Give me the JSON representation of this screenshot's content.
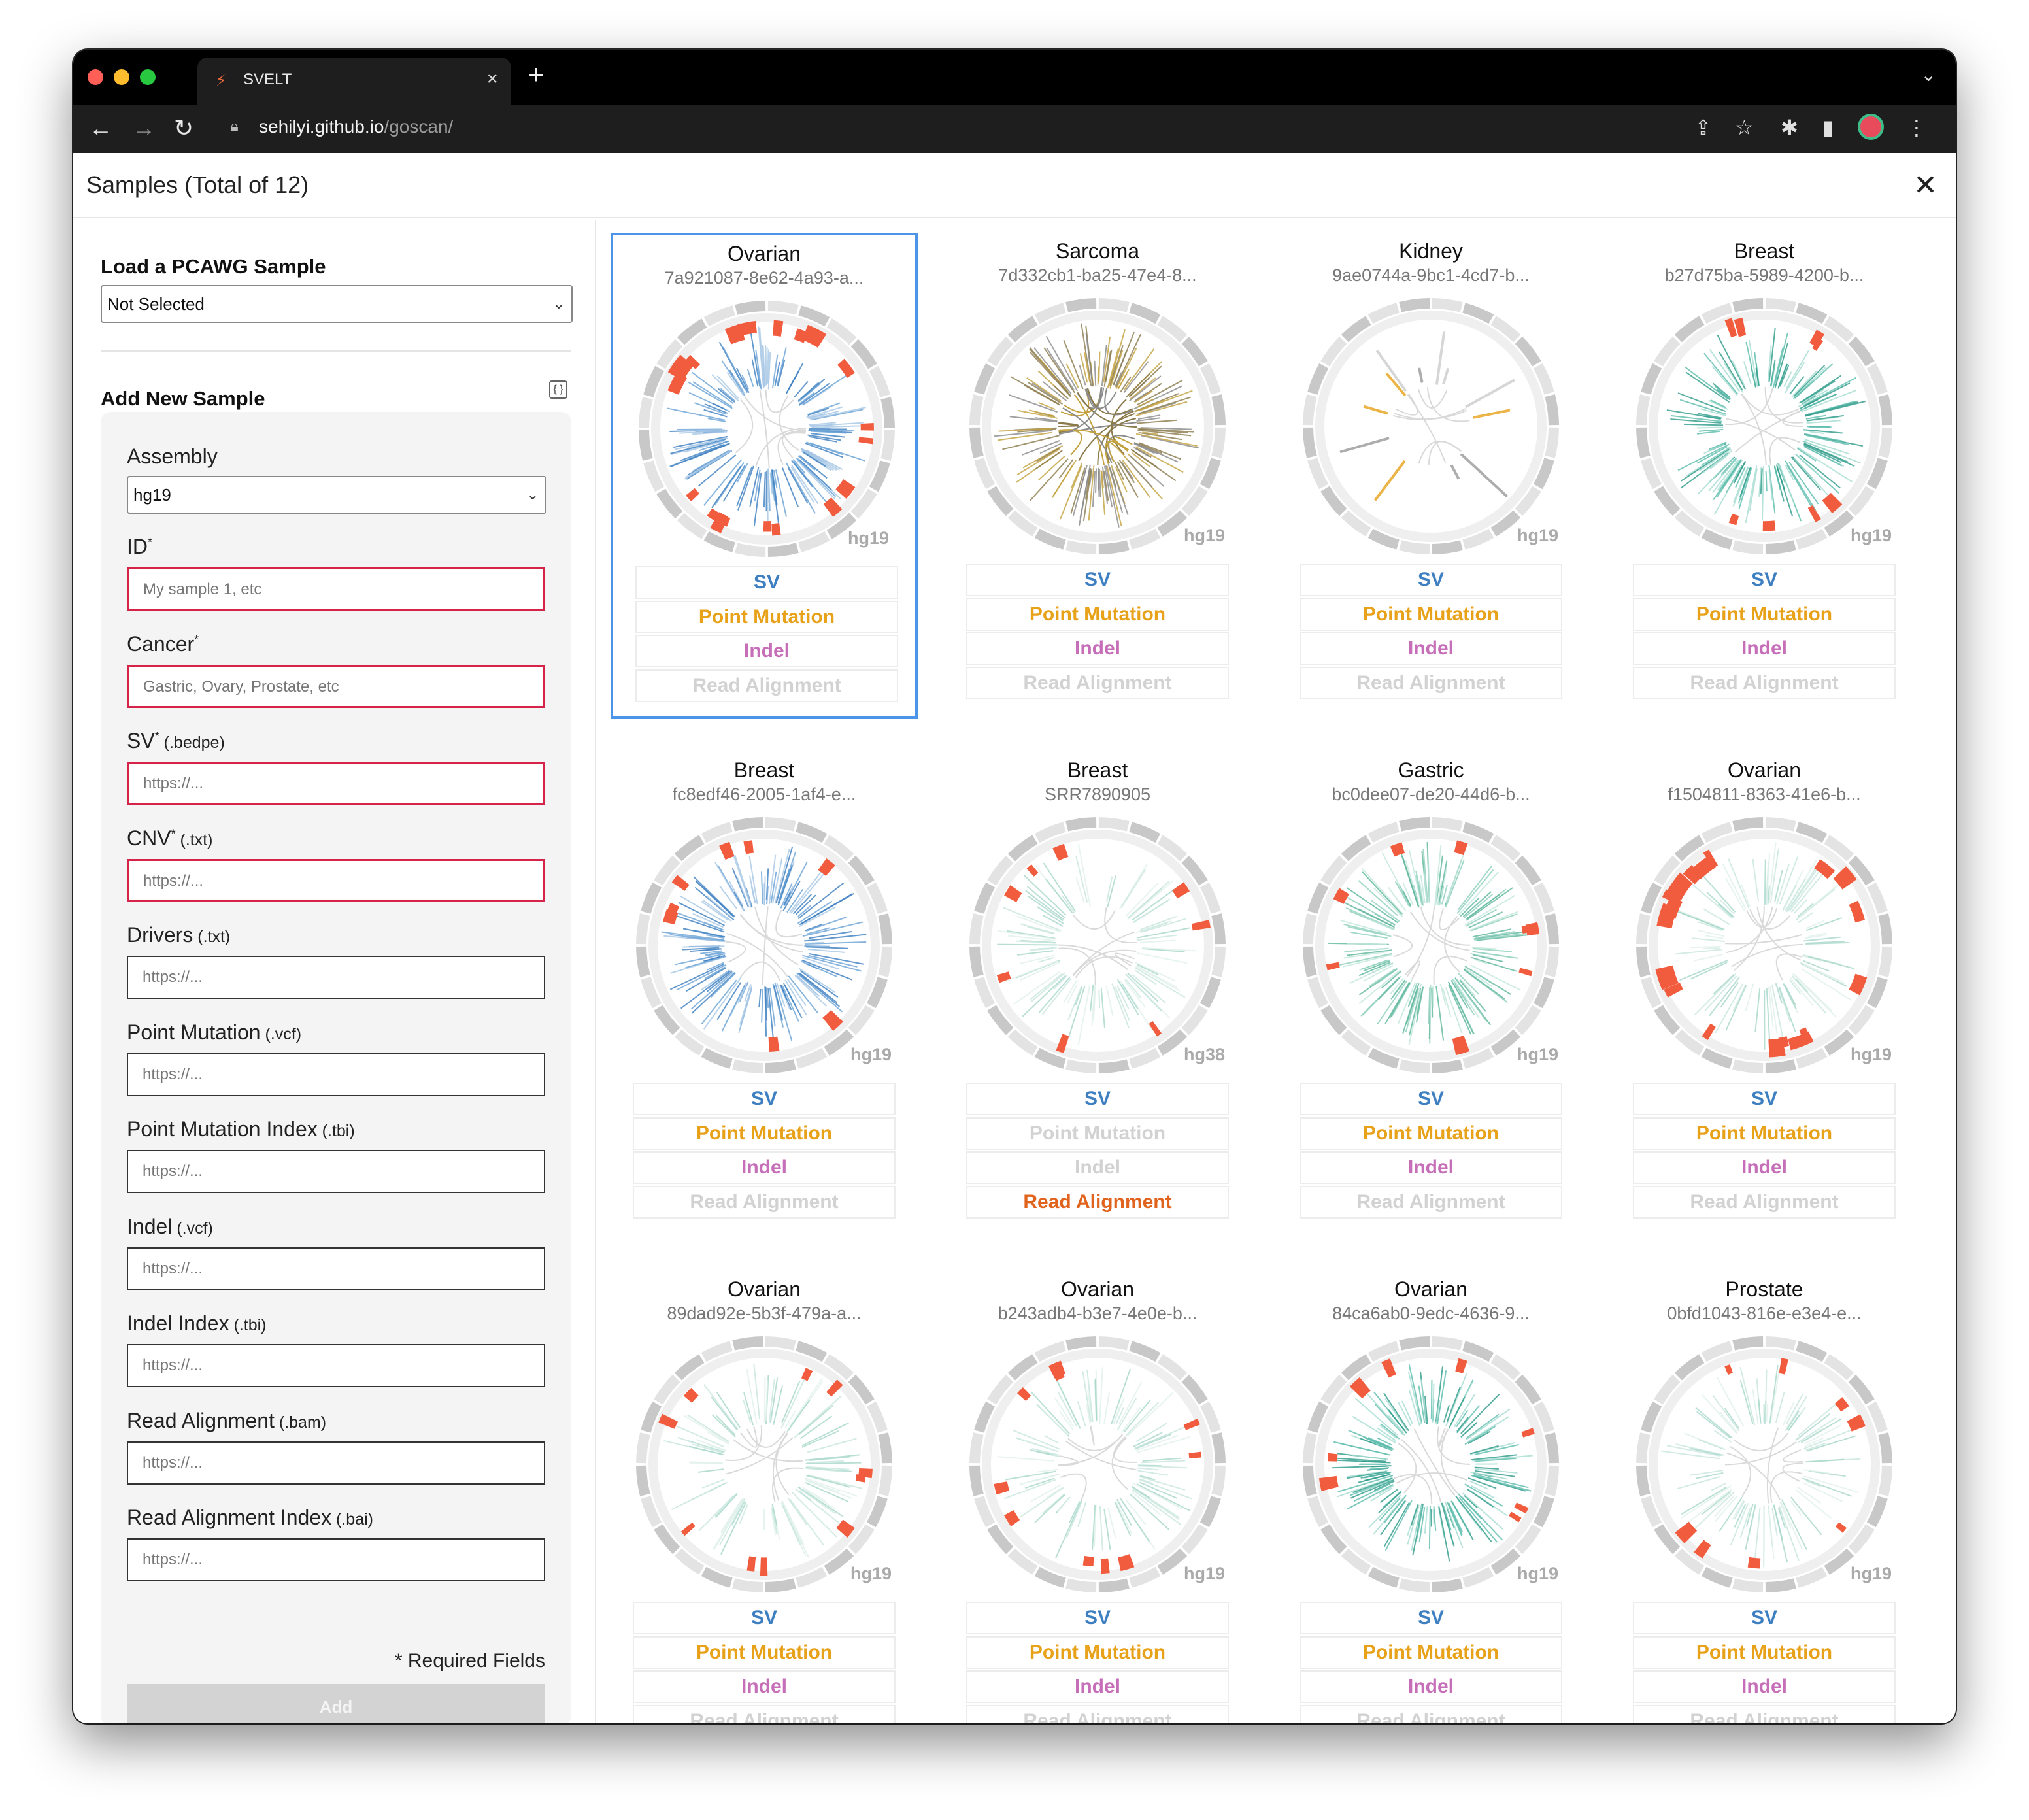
{
  "browser": {
    "tab_title": "SVELT",
    "url_host": "sehilyi.github.io",
    "url_path": "/goscan/"
  },
  "page": {
    "title": "Samples (Total of 12)"
  },
  "sidebar": {
    "load_heading": "Load a PCAWG Sample",
    "load_select_value": "Not Selected",
    "add_heading": "Add New Sample",
    "assembly_label": "Assembly",
    "assembly_value": "hg19",
    "fields": [
      {
        "label": "ID",
        "star": "*",
        "ext": "",
        "placeholder": "My sample 1, etc",
        "required": true
      },
      {
        "label": "Cancer",
        "star": "*",
        "ext": "",
        "placeholder": "Gastric, Ovary, Prostate, etc",
        "required": true
      },
      {
        "label": "SV",
        "star": "*",
        "ext": " (.bedpe)",
        "placeholder": "https://...",
        "required": true
      },
      {
        "label": "CNV",
        "star": "*",
        "ext": " (.txt)",
        "placeholder": "https://...",
        "required": true
      },
      {
        "label": "Drivers",
        "star": "",
        "ext": " (.txt)",
        "placeholder": "https://...",
        "required": false
      },
      {
        "label": "Point Mutation",
        "star": "",
        "ext": " (.vcf)",
        "placeholder": "https://...",
        "required": false
      },
      {
        "label": "Point Mutation Index",
        "star": "",
        "ext": " (.tbi)",
        "placeholder": "https://...",
        "required": false
      },
      {
        "label": "Indel",
        "star": "",
        "ext": " (.vcf)",
        "placeholder": "https://...",
        "required": false
      },
      {
        "label": "Indel Index",
        "star": "",
        "ext": " (.tbi)",
        "placeholder": "https://...",
        "required": false
      },
      {
        "label": "Read Alignment",
        "star": "",
        "ext": " (.bam)",
        "placeholder": "https://...",
        "required": false
      },
      {
        "label": "Read Alignment Index",
        "star": "",
        "ext": " (.bai)",
        "placeholder": "https://...",
        "required": false
      }
    ],
    "required_note": "* Required Fields",
    "add_button": "Add"
  },
  "button_labels": {
    "sv": "SV",
    "point": "Point Mutation",
    "indel": "Indel",
    "read": "Read Alignment"
  },
  "colors": {
    "sv": "#3d7fc1",
    "point": "#e8a21a",
    "indel": "#c66fb8",
    "read": "#e0641e",
    "disabled": "#d2d2d2",
    "cnv": "#f25c3e",
    "selected_border": "#4c94e8"
  },
  "samples": [
    {
      "cancer": "Ovarian",
      "id": "7a921087-8e62-4a93-a...",
      "assembly": "hg19",
      "selected": true,
      "palette": "blue",
      "cnv": "heavy",
      "point": true,
      "indel": true,
      "read": false
    },
    {
      "cancer": "Sarcoma",
      "id": "7d332cb1-ba25-47e4-8...",
      "assembly": "hg19",
      "selected": false,
      "palette": "mixed",
      "cnv": "none",
      "point": true,
      "indel": true,
      "read": false
    },
    {
      "cancer": "Kidney",
      "id": "9ae0744a-9bc1-4cd7-b...",
      "assembly": "hg19",
      "selected": false,
      "palette": "sparse",
      "cnv": "none",
      "point": true,
      "indel": true,
      "read": false
    },
    {
      "cancer": "Breast",
      "id": "b27d75ba-5989-4200-b...",
      "assembly": "hg19",
      "selected": false,
      "palette": "teal",
      "cnv": "light",
      "point": true,
      "indel": true,
      "read": false
    },
    {
      "cancer": "Breast",
      "id": "fc8edf46-2005-1af4-e...",
      "assembly": "hg19",
      "selected": false,
      "palette": "blue",
      "cnv": "light",
      "point": true,
      "indel": true,
      "read": false
    },
    {
      "cancer": "Breast",
      "id": "SRR7890905",
      "assembly": "hg38",
      "selected": false,
      "palette": "light",
      "cnv": "light",
      "point": false,
      "indel": false,
      "read": true
    },
    {
      "cancer": "Gastric",
      "id": "bc0dee07-de20-44d6-b...",
      "assembly": "hg19",
      "selected": false,
      "palette": "green",
      "cnv": "light",
      "point": true,
      "indel": true,
      "read": false
    },
    {
      "cancer": "Ovarian",
      "id": "f1504811-8363-41e6-b...",
      "assembly": "hg19",
      "selected": false,
      "palette": "light",
      "cnv": "heavy",
      "point": true,
      "indel": true,
      "read": false
    },
    {
      "cancer": "Ovarian",
      "id": "89dad92e-5b3f-479a-a...",
      "assembly": "hg19",
      "selected": false,
      "palette": "light",
      "cnv": "medium",
      "point": true,
      "indel": true,
      "read": false
    },
    {
      "cancer": "Ovarian",
      "id": "b243adb4-b3e7-4e0e-b...",
      "assembly": "hg19",
      "selected": false,
      "palette": "light",
      "cnv": "medium",
      "point": true,
      "indel": true,
      "read": false
    },
    {
      "cancer": "Ovarian",
      "id": "84ca6ab0-9edc-4636-9...",
      "assembly": "hg19",
      "selected": false,
      "palette": "teal",
      "cnv": "light",
      "point": true,
      "indel": true,
      "read": false
    },
    {
      "cancer": "Prostate",
      "id": "0bfd1043-816e-e3e4-e...",
      "assembly": "hg19",
      "selected": false,
      "palette": "light",
      "cnv": "light",
      "point": true,
      "indel": true,
      "read": false
    }
  ]
}
